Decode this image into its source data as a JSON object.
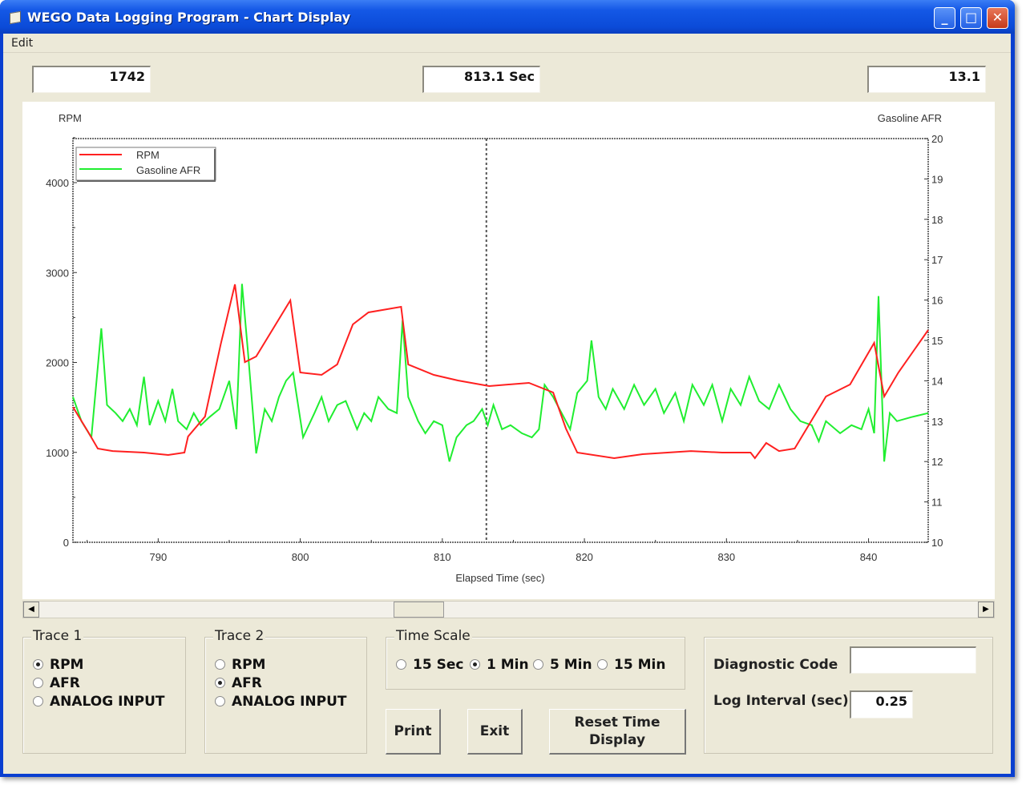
{
  "window": {
    "title": "WEGO Data Logging Program - Chart Display",
    "minimize": "_",
    "maximize": "□",
    "close": "✕"
  },
  "menu": {
    "edit": "Edit"
  },
  "readouts": {
    "trace1_value": "1742",
    "time_value": "813.1 Sec",
    "trace2_value": "13.1"
  },
  "controls": {
    "trace1": {
      "title": "Trace 1",
      "options": [
        "RPM",
        "AFR",
        "ANALOG INPUT"
      ],
      "selected": 0
    },
    "trace2": {
      "title": "Trace 2",
      "options": [
        "RPM",
        "AFR",
        "ANALOG INPUT"
      ],
      "selected": 1
    },
    "time_scale": {
      "title": "Time Scale",
      "options": [
        "15 Sec",
        "1 Min",
        "5 Min",
        "15 Min"
      ],
      "selected": 1
    },
    "buttons": {
      "print": "Print",
      "exit": "Exit",
      "reset": "Reset Time Display"
    },
    "diagnostic_code_label": "Diagnostic Code",
    "diagnostic_code_value": "",
    "log_interval_label": "Log Interval (sec)",
    "log_interval_value": "0.25"
  },
  "scrollbar": {
    "left_arrow": "◀",
    "right_arrow": "▶"
  },
  "chart_data": {
    "type": "line",
    "xlabel": "Elapsed Time (sec)",
    "ylabel_left": "RPM",
    "ylabel_right": "Gasoline AFR",
    "xlim": [
      784,
      844.2
    ],
    "ylim_left": [
      0,
      4490
    ],
    "ylim_right": [
      10,
      20
    ],
    "x_ticks": [
      790,
      800,
      810,
      820,
      830,
      840
    ],
    "y_ticks_left": [
      0,
      1000,
      2000,
      3000,
      4000
    ],
    "y_ticks_right": [
      10,
      11,
      12,
      13,
      14,
      15,
      16,
      17,
      18,
      19,
      20
    ],
    "cursor_x": 813.1,
    "legend_position": "top-left",
    "colors": {
      "rpm": "#ff2020",
      "afr": "#20ee30"
    },
    "series": [
      {
        "name": "RPM",
        "axis": "left",
        "points": [
          [
            784,
            1505
          ],
          [
            785.1,
            1220
          ],
          [
            785.75,
            1042
          ],
          [
            786.8,
            1015
          ],
          [
            789,
            998
          ],
          [
            790.7,
            971
          ],
          [
            791.85,
            998
          ],
          [
            792.1,
            1176
          ],
          [
            793.3,
            1399
          ],
          [
            794.4,
            2200
          ],
          [
            795.4,
            2869
          ],
          [
            796.1,
            2004
          ],
          [
            796.9,
            2067
          ],
          [
            799.3,
            2690
          ],
          [
            800,
            1889
          ],
          [
            801.5,
            1862
          ],
          [
            802.6,
            1978
          ],
          [
            803.7,
            2423
          ],
          [
            804.8,
            2557
          ],
          [
            807.1,
            2619
          ],
          [
            807.6,
            1978
          ],
          [
            809.4,
            1862
          ],
          [
            811.1,
            1800
          ],
          [
            813.3,
            1737
          ],
          [
            816.1,
            1773
          ],
          [
            817.8,
            1666
          ],
          [
            818.7,
            1265
          ],
          [
            819.5,
            998
          ],
          [
            822.1,
            935
          ],
          [
            824.1,
            980
          ],
          [
            827.5,
            1015
          ],
          [
            829.7,
            998
          ],
          [
            831.7,
            998
          ],
          [
            832,
            935
          ],
          [
            832.8,
            1105
          ],
          [
            833.7,
            1015
          ],
          [
            834.8,
            1042
          ],
          [
            837,
            1621
          ],
          [
            838.7,
            1755
          ],
          [
            840.4,
            2218
          ],
          [
            841.1,
            1621
          ],
          [
            842.1,
            1889
          ],
          [
            844.2,
            2361
          ]
        ]
      },
      {
        "name": "Gasoline AFR",
        "axis": "right",
        "points": [
          [
            784,
            13.6
          ],
          [
            784.6,
            13
          ],
          [
            785.3,
            12.6
          ],
          [
            786,
            15.3
          ],
          [
            786.4,
            13.4
          ],
          [
            787,
            13.2
          ],
          [
            787.5,
            13
          ],
          [
            788,
            13.3
          ],
          [
            788.5,
            12.9
          ],
          [
            789,
            14.1
          ],
          [
            789.4,
            12.9
          ],
          [
            790,
            13.5
          ],
          [
            790.5,
            13
          ],
          [
            791,
            13.8
          ],
          [
            791.4,
            13
          ],
          [
            792,
            12.8
          ],
          [
            792.5,
            13.2
          ],
          [
            793,
            12.9
          ],
          [
            793.6,
            13.1
          ],
          [
            794.3,
            13.3
          ],
          [
            795,
            14
          ],
          [
            795.5,
            12.8
          ],
          [
            795.9,
            16.4
          ],
          [
            796.3,
            14.8
          ],
          [
            796.9,
            12.2
          ],
          [
            797.5,
            13.3
          ],
          [
            798,
            13
          ],
          [
            798.5,
            13.6
          ],
          [
            799,
            14
          ],
          [
            799.5,
            14.2
          ],
          [
            800.2,
            12.6
          ],
          [
            801,
            13.2
          ],
          [
            801.5,
            13.6
          ],
          [
            802,
            13
          ],
          [
            802.6,
            13.4
          ],
          [
            803.2,
            13.5
          ],
          [
            804,
            12.8
          ],
          [
            804.5,
            13.2
          ],
          [
            805,
            13
          ],
          [
            805.5,
            13.6
          ],
          [
            806.2,
            13.3
          ],
          [
            806.8,
            13.2
          ],
          [
            807.2,
            15.5
          ],
          [
            807.6,
            13.6
          ],
          [
            808.3,
            13
          ],
          [
            808.8,
            12.7
          ],
          [
            809.4,
            13
          ],
          [
            810,
            12.9
          ],
          [
            810.5,
            12
          ],
          [
            811,
            12.6
          ],
          [
            811.7,
            12.9
          ],
          [
            812.2,
            13
          ],
          [
            812.8,
            13.3
          ],
          [
            813.2,
            12.9
          ],
          [
            813.6,
            13.4
          ],
          [
            814.2,
            12.8
          ],
          [
            814.8,
            12.9
          ],
          [
            815.6,
            12.7
          ],
          [
            816.3,
            12.6
          ],
          [
            816.8,
            12.8
          ],
          [
            817.2,
            13.9
          ],
          [
            817.8,
            13.6
          ],
          [
            818.4,
            13.2
          ],
          [
            819,
            12.8
          ],
          [
            819.5,
            13.7
          ],
          [
            820.2,
            14
          ],
          [
            820.5,
            15
          ],
          [
            821,
            13.6
          ],
          [
            821.5,
            13.3
          ],
          [
            822,
            13.8
          ],
          [
            822.8,
            13.3
          ],
          [
            823.5,
            13.9
          ],
          [
            824.2,
            13.4
          ],
          [
            825,
            13.8
          ],
          [
            825.6,
            13.2
          ],
          [
            826.4,
            13.7
          ],
          [
            827,
            13
          ],
          [
            827.6,
            13.9
          ],
          [
            828.4,
            13.4
          ],
          [
            829,
            13.9
          ],
          [
            829.7,
            13
          ],
          [
            830.3,
            13.8
          ],
          [
            831,
            13.4
          ],
          [
            831.6,
            14.1
          ],
          [
            832.3,
            13.5
          ],
          [
            833,
            13.3
          ],
          [
            833.7,
            13.9
          ],
          [
            834.5,
            13.3
          ],
          [
            835.2,
            13
          ],
          [
            836,
            12.9
          ],
          [
            836.5,
            12.5
          ],
          [
            837,
            13
          ],
          [
            838,
            12.7
          ],
          [
            838.8,
            12.9
          ],
          [
            839.5,
            12.8
          ],
          [
            840,
            13.3
          ],
          [
            840.4,
            12.7
          ],
          [
            840.7,
            16.1
          ],
          [
            841.1,
            12
          ],
          [
            841.5,
            13.2
          ],
          [
            842,
            13
          ],
          [
            843,
            13.1
          ],
          [
            844.2,
            13.2
          ]
        ]
      }
    ]
  }
}
